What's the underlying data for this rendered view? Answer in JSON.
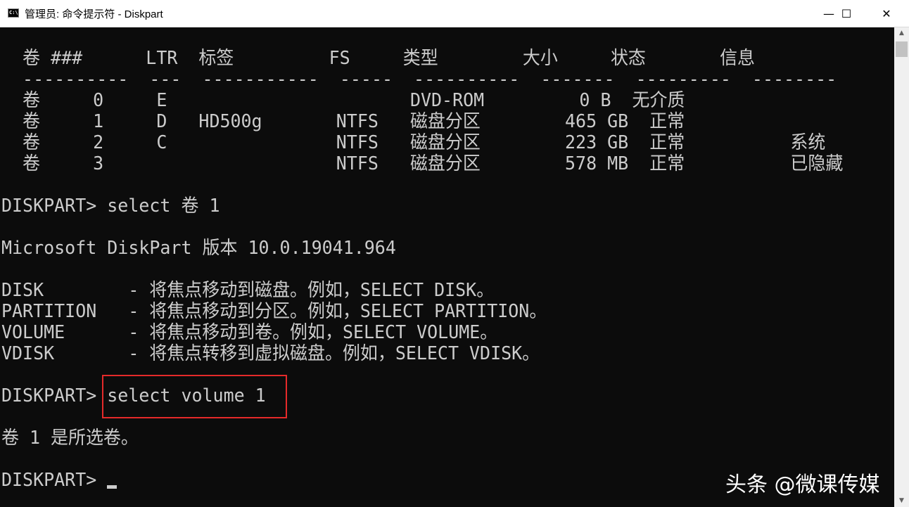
{
  "window": {
    "title": "管理员: 命令提示符 - Diskpart",
    "icon_text": "C:\\.",
    "minimize_icon": "—",
    "maximize_icon": "☐",
    "close_icon": "✕"
  },
  "console": {
    "lines": [
      "  卷 ###      LTR  标签         FS     类型        大小     状态       信息",
      "  ----------  ---  -----------  -----  ----------  -------  ---------  --------",
      "  卷     0     E                       DVD-ROM         0 B  无介质",
      "  卷     1     D   HD500g       NTFS   磁盘分区        465 GB  正常",
      "  卷     2     C                NTFS   磁盘分区        223 GB  正常          系统",
      "  卷     3                      NTFS   磁盘分区        578 MB  正常          已隐藏",
      "DISKPART> select 卷 1",
      "Microsoft DiskPart 版本 10.0.19041.964",
      "DISK        - 将焦点移动到磁盘。例如，SELECT DISK。",
      "PARTITION   - 将焦点移动到分区。例如，SELECT PARTITION。",
      "VOLUME      - 将焦点移动到卷。例如，SELECT VOLUME。",
      "VDISK       - 将焦点转移到虚拟磁盘。例如，SELECT VDISK。",
      "DISKPART> select volume 1",
      "卷 1 是所选卷。",
      "DISKPART> "
    ]
  },
  "watermark": "头条 @微课传媒",
  "scrollbar": {
    "up_icon": "▲",
    "down_icon": "▼"
  },
  "colors": {
    "console_bg": "#0c0c0c",
    "console_text": "#cccccc",
    "highlight_box": "#e52a2a"
  }
}
